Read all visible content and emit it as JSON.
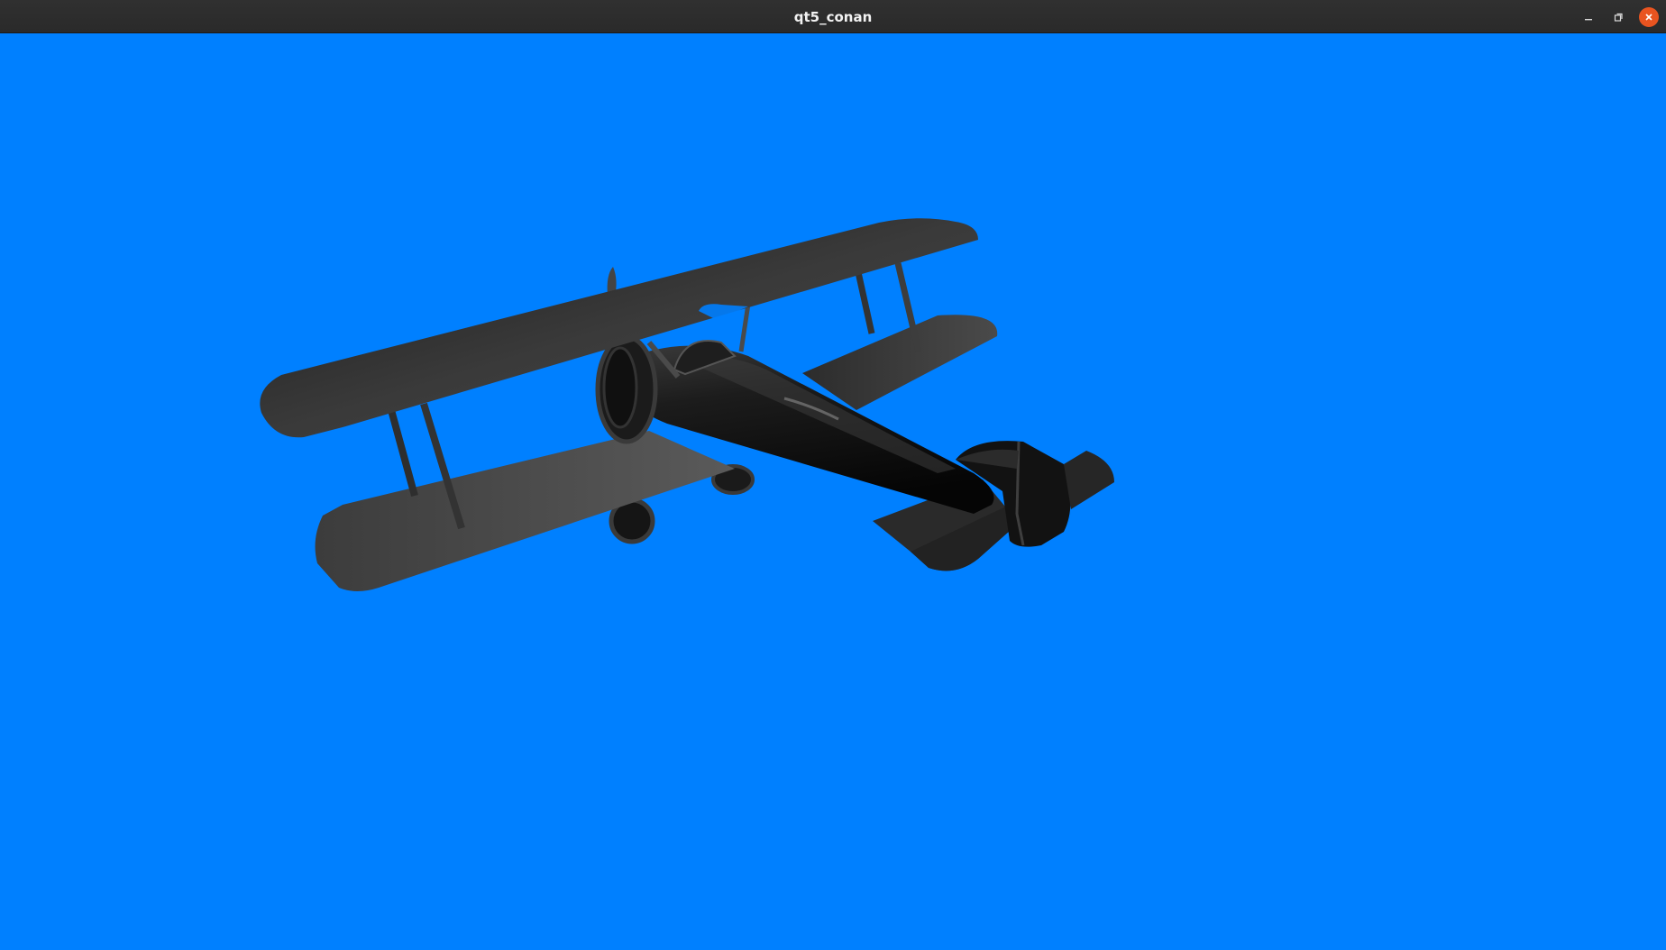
{
  "window": {
    "title": "qt5_conan",
    "controls": {
      "minimize_icon": "minimize-icon",
      "maximize_icon": "restore-icon",
      "close_icon": "close-icon"
    },
    "colors": {
      "titlebar": "#2c2c2c",
      "close_button": "#e95420"
    }
  },
  "scene": {
    "background_color": "#0080ff",
    "model": "biplane",
    "model_color": "#2a2a2a"
  }
}
